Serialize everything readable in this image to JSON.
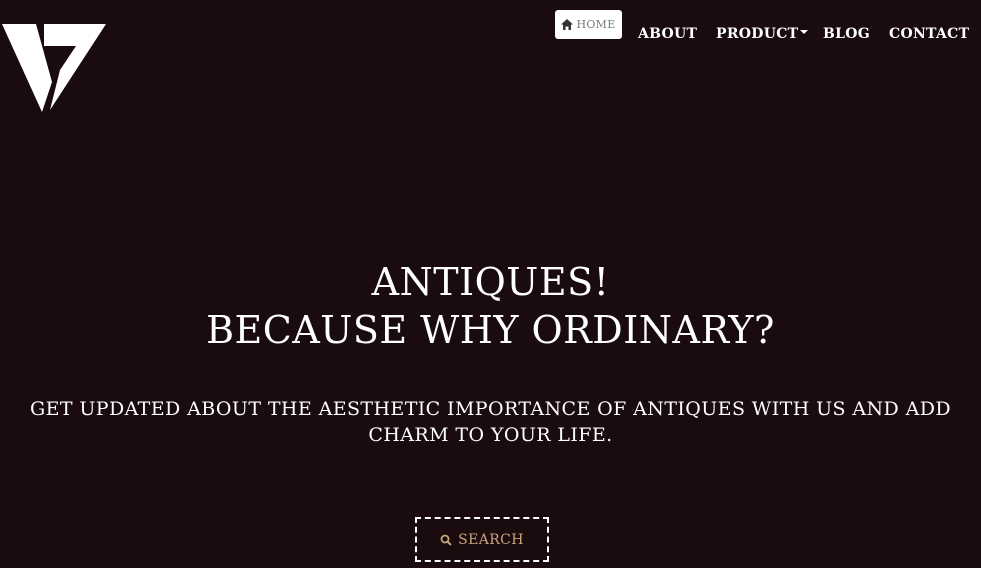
{
  "brand": {
    "logo_icon": "v-logo-icon"
  },
  "nav": {
    "home_label": "HOME",
    "home_icon": "home-icon",
    "about_label": "ABOUT",
    "product_label": "PRODUCT",
    "product_icon": "caret-down-icon",
    "blog_label": "BLOG",
    "contact_label": "CONTACT"
  },
  "hero": {
    "title_line1": "ANTIQUES!",
    "title_line2": "BECAUSE WHY ORDINARY?",
    "subtitle": "GET UPDATED ABOUT THE AESTHETIC IMPORTANCE OF ANTIQUES WITH US AND ADD CHARM TO YOUR LIFE.",
    "search_label": "SEARCH",
    "search_icon": "search-icon"
  },
  "colors": {
    "background": "#1a0b0e",
    "text": "#ffffff",
    "accent": "#c9a57d"
  }
}
